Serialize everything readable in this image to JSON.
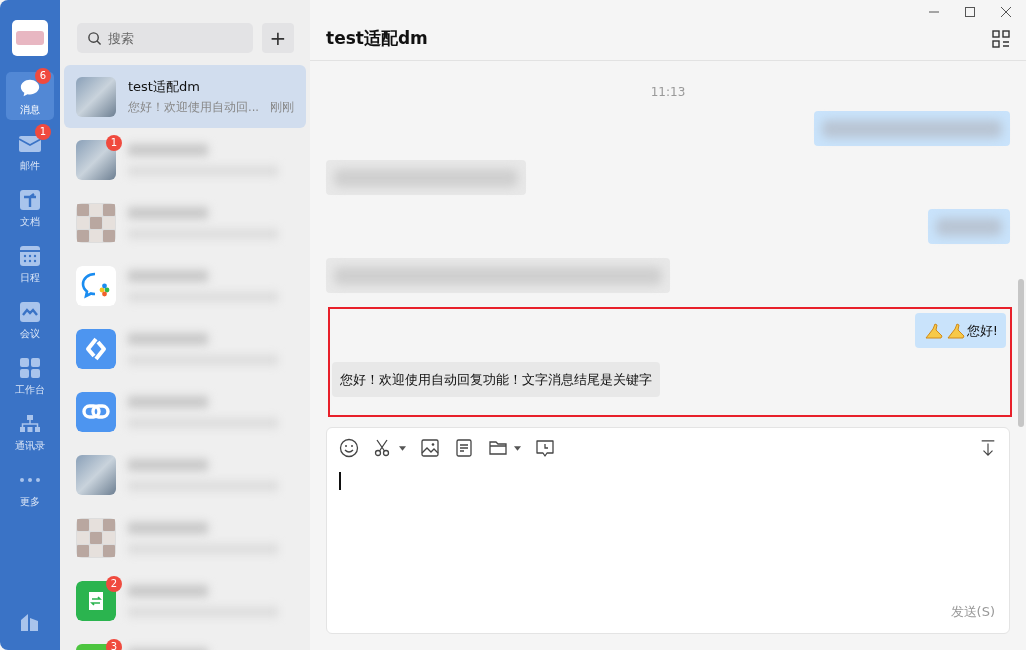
{
  "nav": {
    "items": [
      {
        "kind": "chat",
        "label": "消息",
        "badge": "6",
        "selected": true
      },
      {
        "kind": "mail",
        "label": "邮件",
        "badge": "1",
        "selected": false
      },
      {
        "kind": "doc",
        "label": "文档",
        "selected": false
      },
      {
        "kind": "calendar",
        "label": "日程",
        "selected": false
      },
      {
        "kind": "meeting",
        "label": "会议",
        "selected": false
      },
      {
        "kind": "apps",
        "label": "工作台",
        "selected": false
      },
      {
        "kind": "org",
        "label": "通讯录",
        "selected": false
      },
      {
        "kind": "more",
        "label": "更多",
        "selected": false
      }
    ]
  },
  "chat_list": {
    "search": {
      "placeholder": "搜索"
    },
    "add_button": "+",
    "items": [
      {
        "kind": "text",
        "avatar": {
          "kind": "photo"
        },
        "name": "test适配dm",
        "preview": "您好！欢迎使用自动回...",
        "time": "刚刚",
        "selected": true
      },
      {
        "kind": "blurred",
        "avatar": {
          "kind": "photo"
        },
        "badge": "1",
        "selected": false
      },
      {
        "kind": "blurred",
        "avatar": {
          "kind": "mosaic"
        },
        "selected": false
      },
      {
        "kind": "blurred",
        "avatar": {
          "kind": "chat-logo"
        },
        "selected": false
      },
      {
        "kind": "blurred",
        "avatar": {
          "kind": "sync"
        },
        "selected": false
      },
      {
        "kind": "blurred",
        "avatar": {
          "kind": "link"
        },
        "selected": false
      },
      {
        "kind": "blurred",
        "avatar": {
          "kind": "photo"
        },
        "selected": false
      },
      {
        "kind": "blurred",
        "avatar": {
          "kind": "mosaic"
        },
        "selected": false
      },
      {
        "kind": "blurred",
        "avatar": {
          "kind": "transfer"
        },
        "badge": "2",
        "selected": false
      },
      {
        "kind": "blurred",
        "avatar": {
          "kind": "green"
        },
        "badge": "3",
        "selected": false
      }
    ]
  },
  "chat": {
    "title": "test适配dm",
    "timestamp": "11:13",
    "messages": [
      {
        "kind": "blurred",
        "outgoing": true
      },
      {
        "kind": "blurred",
        "outgoing": false
      },
      {
        "kind": "blurred",
        "outgoing": true
      },
      {
        "kind": "blurred",
        "outgoing": false
      }
    ],
    "highlight_box": {
      "messages": [
        {
          "kind": "emoji-text",
          "outgoing": true,
          "text": "您好!"
        },
        {
          "kind": "text",
          "outgoing": false,
          "text": "您好！欢迎使用自动回复功能！文字消息结尾是关键字"
        }
      ]
    }
  },
  "composer": {
    "send": "发送(S)"
  }
}
